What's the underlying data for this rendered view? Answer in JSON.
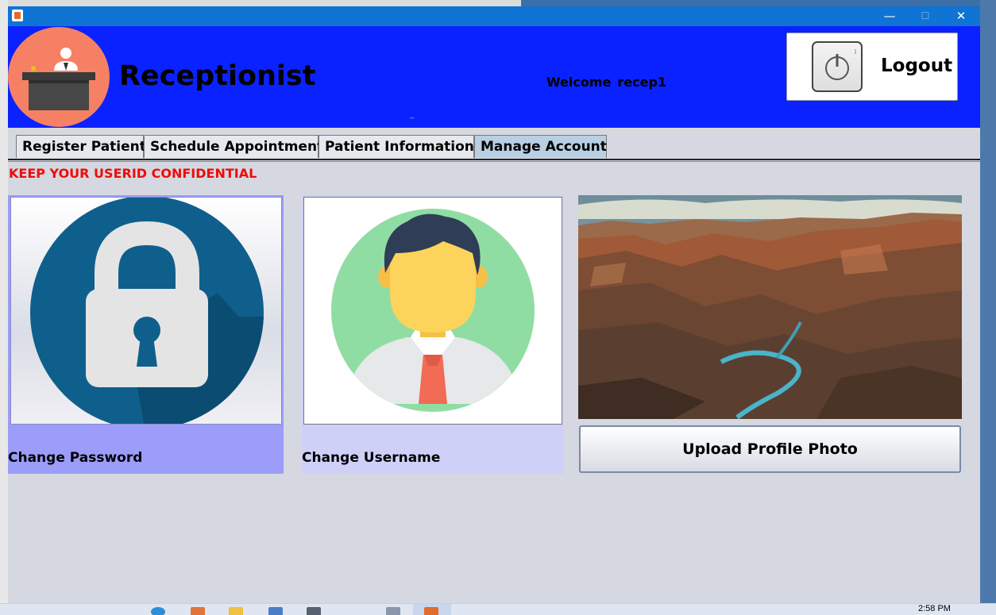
{
  "window": {
    "minimize_glyph": "—",
    "maximize_glyph": "☐",
    "close_glyph": "✕"
  },
  "header": {
    "role_title": "Receptionist",
    "welcome_label": "Welcome",
    "username": "recep1",
    "logout_label": "Logout",
    "logo_icon": "receptionist-desk-icon",
    "logout_icon": "power-icon"
  },
  "tabs": [
    {
      "label": "Register Patient",
      "active": false
    },
    {
      "label": "Schedule Appointment",
      "active": false
    },
    {
      "label": "Patient Information",
      "active": false
    },
    {
      "label": "Manage Account",
      "active": true
    }
  ],
  "content": {
    "warning": "KEEP YOUR USERID CONFIDENTIAL",
    "change_password_label": "Change Password",
    "change_username_label": "Change Username",
    "upload_photo_label": "Upload Profile Photo",
    "change_password_icon": "lock-icon",
    "change_username_icon": "user-avatar-icon",
    "profile_photo": "canyon-landscape-image"
  },
  "taskbar": {
    "clock": "2:58 PM"
  },
  "colors": {
    "header_bg": "#0a22ff",
    "titlebar_bg": "#0f74d4",
    "warning_text": "#f00a0a",
    "password_panel": "#9b9df8",
    "username_panel": "#cfd0f8",
    "active_tab": "#b8cfe4"
  }
}
